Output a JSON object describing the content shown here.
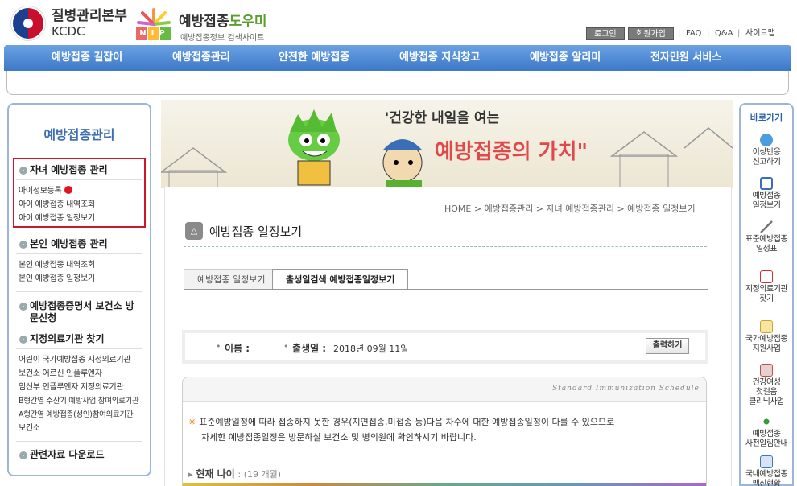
{
  "header": {
    "org_name": "질병관리본부",
    "org_abbr": "KCDC",
    "nip_label": "NIP",
    "site_title_a": "예방접종",
    "site_title_b": "도우미",
    "site_sub": "예방접종정보 검색사이트",
    "login": "로그인",
    "join": "회원가입",
    "faq": "FAQ",
    "qna": "Q&A",
    "sitemap": "사이트맵",
    "sep": "|"
  },
  "gnb": [
    "예방접종 길잡이",
    "예방접종관리",
    "안전한 예방접종",
    "예방접종 지식창고",
    "예방접종 알리미",
    "전자민원 서비스"
  ],
  "lnb": {
    "title": "예방접종관리",
    "bullet": "›",
    "s1": "자녀 예방접종 관리",
    "s1_items": [
      "아이정보등록",
      "아이 예방접종 내역조회",
      "아이 예방접종 일정보기"
    ],
    "s2": "본인 예방접종 관리",
    "s2_items": [
      "본인 예방접종 내역조회",
      "본인 예방접종 일정보기"
    ],
    "s3a": "예방접종증명서 보건소 방",
    "s3b": "문신청",
    "s4": "지정의료기관 찾기",
    "s4_items": [
      "어린이 국가예방접종 지정의료기관",
      "보건소 어르신 인플루엔자",
      "임신부 인플루엔자 지정의료기관",
      "B형간염 주산기 예방사업 참여의료기관",
      "A형간염 예방접종(성인)참여의료기관",
      "보건소"
    ],
    "s5": "관련자료 다운로드"
  },
  "banner": {
    "line1": "'건강한 내일을 여는",
    "line2": "예방접종의 가치\""
  },
  "breadcrumb": "HOME > 예방접종관리 > 자녀 예방접종관리 > 예방접종 일정보기",
  "page_title": "예방접종 일정보기",
  "page_icon": "△",
  "tabs": [
    "예방접종 일정보기",
    "출생일검색 예방접종일정보기"
  ],
  "info": {
    "name_label": "이름 :",
    "name_value": "",
    "birth_label": "출생일 :",
    "birth_value": "2018년 09월 11일",
    "print": "출력하기",
    "dot": "•"
  },
  "schedule": {
    "en_title": "Standard Immunization Schedule",
    "note_mark": "※",
    "note1": "표준예방일정에 따라 접종하지 못한 경우(지연접종,미접종 등)다음 차수에 대한 예방접종일정이 다를 수 있으므로",
    "note2": "자세한 예방접종일정은 방문하실 보건소 및 병의원에 확인하시기 바랍니다.",
    "age_arrow": "▸",
    "age_label": "현재 나이",
    "age_value": ": (19 개월)"
  },
  "quick": {
    "title": "바로가기",
    "items": [
      {
        "a": "이상반응",
        "b": "신고하기",
        "c": ""
      },
      {
        "a": "예방접종",
        "b": "일정보기",
        "c": ""
      },
      {
        "a": "표준예방접종",
        "b": "일정표",
        "c": ""
      },
      {
        "a": "지정의료기관",
        "b": "찾기",
        "c": ""
      },
      {
        "a": "국가예방접종",
        "b": "지원사업",
        "c": ""
      },
      {
        "a": "건강여성",
        "b": "첫걸음",
        "c": "클리닉사업"
      },
      {
        "a": "예방접종",
        "b": "사전알림안내",
        "c": ""
      },
      {
        "a": "국내예방접종",
        "b": "백신현황",
        "c": ""
      }
    ],
    "icon_colors": [
      "#4a9ee0",
      "#3a6fb8",
      "#777",
      "#d03030",
      "#d0a030",
      "#c05050",
      "#3a9a3a",
      "#3a78c0"
    ]
  },
  "colors": {
    "gnb": "#4f8bd6",
    "accent_red": "#d0142c",
    "title_blue": "#3d6fb0"
  }
}
